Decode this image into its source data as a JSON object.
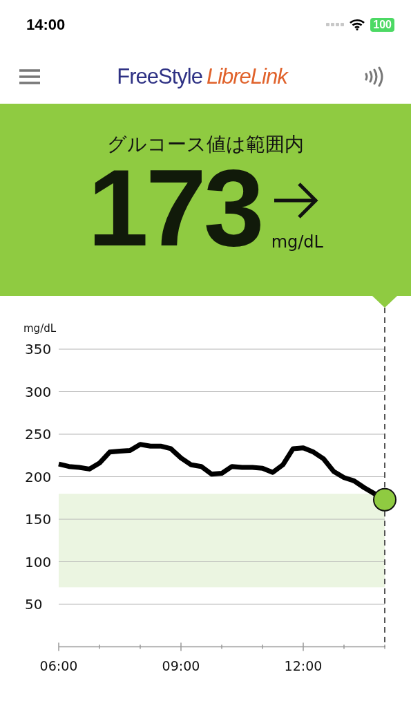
{
  "status_bar": {
    "time": "14:00",
    "battery": "100"
  },
  "header": {
    "logo": [
      {
        "text": "FreeStyle",
        "kind": "plain"
      },
      {
        "text": "LibreLink",
        "kind": "accent"
      }
    ]
  },
  "reading": {
    "status": "グルコース値は範囲内",
    "value": "173",
    "unit": "mg/dL"
  },
  "chart": {
    "chart_data": {
      "type": "line",
      "ylabel": "mg/dL",
      "x": [
        6,
        6.25,
        6.5,
        6.75,
        7,
        7.25,
        7.5,
        7.75,
        8,
        8.25,
        8.5,
        8.75,
        9,
        9.25,
        9.5,
        9.75,
        10,
        10.25,
        10.5,
        10.75,
        11,
        11.25,
        11.5,
        11.75,
        12,
        12.25,
        12.5,
        12.75,
        13,
        13.25,
        13.5,
        13.75,
        14
      ],
      "values": [
        215,
        212,
        211,
        209,
        216,
        229,
        230,
        231,
        238,
        236,
        236,
        233,
        222,
        214,
        212,
        203,
        204,
        212,
        211,
        211,
        210,
        205,
        214,
        233,
        234,
        229,
        221,
        206,
        199,
        195,
        187,
        180,
        173
      ],
      "xlim": [
        6,
        14
      ],
      "ylim": [
        0,
        350
      ],
      "xticks": [
        {
          "value": 6,
          "label": "06:00"
        },
        {
          "value": 9,
          "label": "09:00"
        },
        {
          "value": 12,
          "label": "12:00"
        }
      ],
      "yticks": [
        50,
        100,
        150,
        200,
        250,
        300,
        350
      ],
      "grid": true,
      "bands": [
        {
          "axis": "y",
          "from": 70,
          "to": 180
        }
      ]
    }
  }
}
